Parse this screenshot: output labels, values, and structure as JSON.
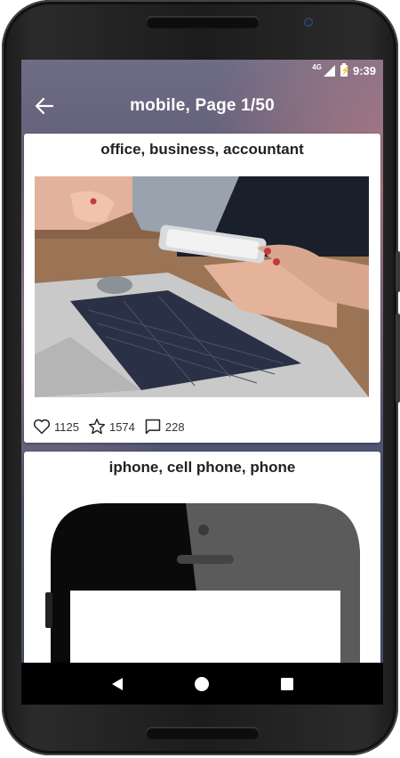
{
  "status_bar": {
    "network": "4G",
    "time": "9:39"
  },
  "app_bar": {
    "title": "mobile, Page 1/50",
    "back_icon": "arrow-left-icon"
  },
  "cards": [
    {
      "title": "office, business, accountant",
      "likes": "1125",
      "favorites": "1574",
      "comments": "228"
    },
    {
      "title": "iphone, cell phone, phone"
    }
  ],
  "nav_bar": {
    "back_icon": "triangle-back-icon",
    "home_icon": "circle-home-icon",
    "recents_icon": "square-recents-icon"
  },
  "colors": {
    "app_bar_text": "#ffffff",
    "card_bg": "#ffffff",
    "nav_bar_bg": "#000000"
  }
}
